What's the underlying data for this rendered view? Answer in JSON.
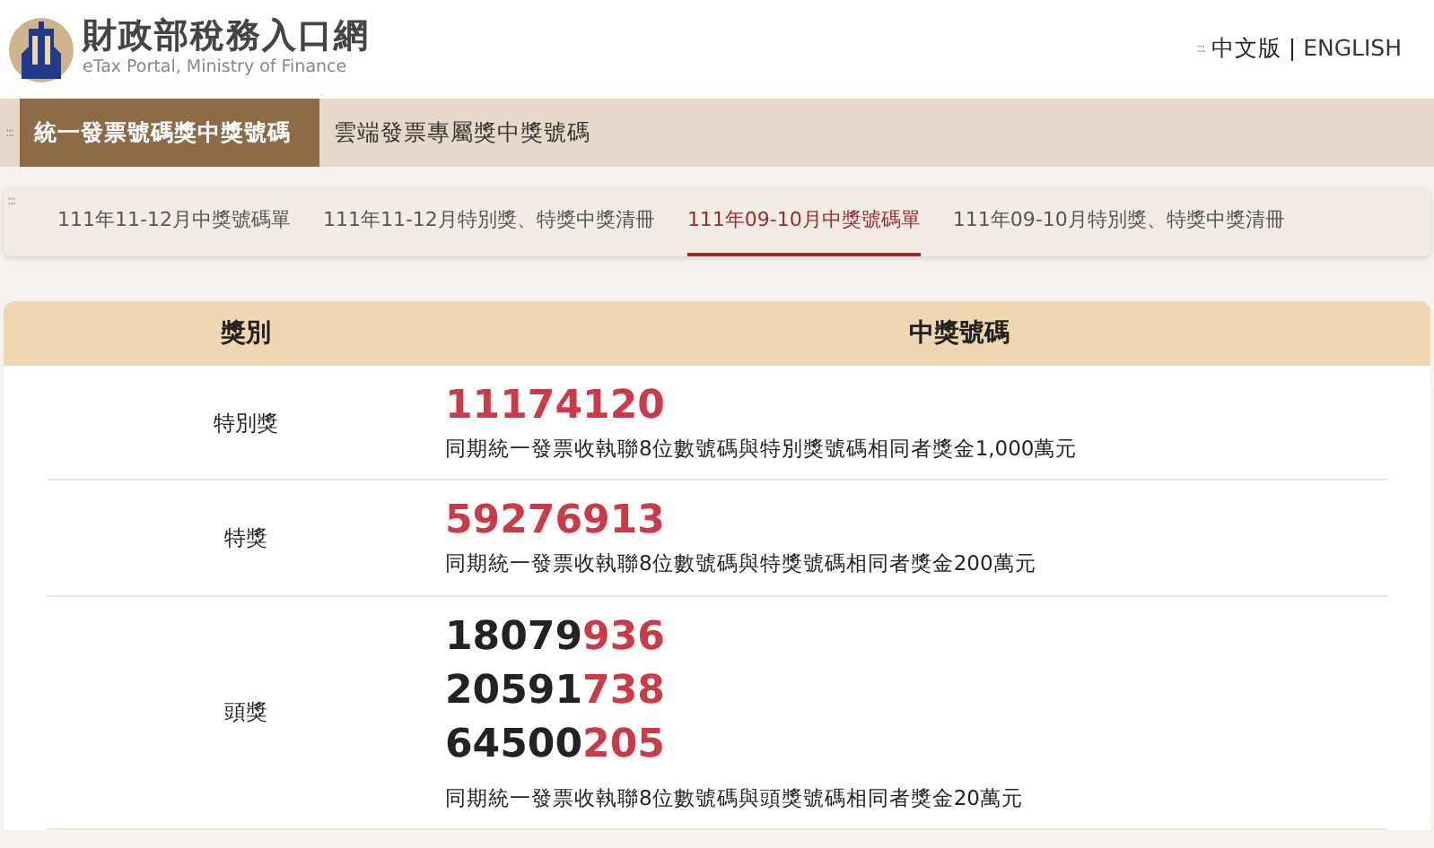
{
  "header": {
    "site_title": "財政部稅務入口網",
    "site_subtitle": "eTax Portal, Ministry of Finance",
    "access_key": ":::",
    "languages": [
      {
        "label": "中文版",
        "selected": true
      },
      {
        "label": "ENGLISH",
        "selected": false
      }
    ],
    "separator": "|"
  },
  "main_nav": {
    "access_key": ":::",
    "items": [
      {
        "label": "統一發票號碼獎中獎號碼",
        "selected": true
      },
      {
        "label": "雲端發票專屬獎中獎號碼",
        "selected": false
      }
    ]
  },
  "period_tabs": {
    "access_key": ":::",
    "items": [
      {
        "label": "111年11-12月中獎號碼單",
        "selected": false
      },
      {
        "label": "111年11-12月特別獎、特獎中獎清冊",
        "selected": false
      },
      {
        "label": "111年09-10月中獎號碼單",
        "selected": true
      },
      {
        "label": "111年09-10月特別獎、特獎中獎清冊",
        "selected": false
      }
    ]
  },
  "table": {
    "columns": [
      "獎別",
      "中獎號碼"
    ],
    "rows": [
      {
        "prize": "特別獎",
        "numbers": [
          {
            "highlight": "11174120"
          }
        ],
        "note": "同期統一發票收執聯8位數號碼與特別獎號碼相同者獎金1,000萬元"
      },
      {
        "prize": "特獎",
        "numbers": [
          {
            "highlight": "59276913"
          }
        ],
        "note": "同期統一發票收執聯8位數號碼與特獎號碼相同者獎金200萬元"
      },
      {
        "prize": "頭獎",
        "numbers": [
          {
            "plain": "18079",
            "highlight": "936"
          },
          {
            "plain": "20591",
            "highlight": "738"
          },
          {
            "plain": "64500",
            "highlight": "205"
          }
        ],
        "note": "同期統一發票收執聯8位數號碼與頭獎號碼相同者獎金20萬元"
      }
    ]
  }
}
